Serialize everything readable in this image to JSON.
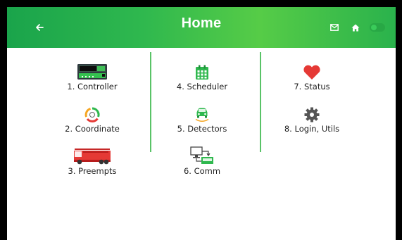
{
  "header": {
    "title": "Home",
    "accent": "#2fb84e"
  },
  "menu": [
    {
      "label": "1. Controller",
      "icon": "controller-icon"
    },
    {
      "label": "2. Coordinate",
      "icon": "coordinate-icon"
    },
    {
      "label": "3. Preempts",
      "icon": "fire-truck-icon"
    },
    {
      "label": "4. Scheduler",
      "icon": "calendar-icon"
    },
    {
      "label": "5. Detectors",
      "icon": "car-detector-icon"
    },
    {
      "label": "6. Comm",
      "icon": "network-icon"
    },
    {
      "label": "7. Status",
      "icon": "heart-icon"
    },
    {
      "label": "8. Login, Utils",
      "icon": "gear-icon"
    }
  ]
}
